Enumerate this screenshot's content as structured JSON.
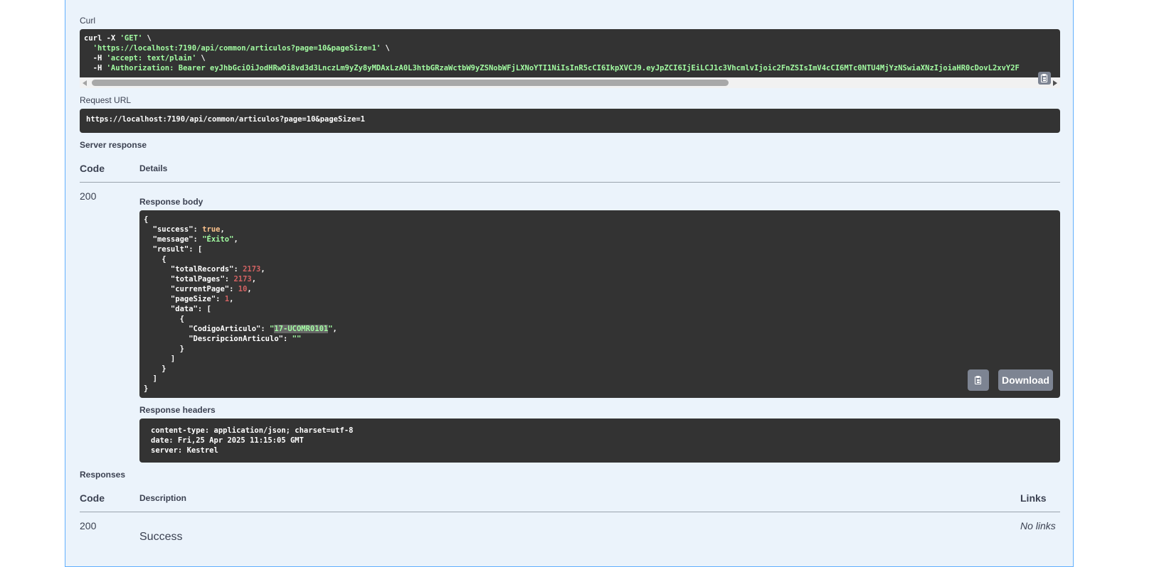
{
  "curl": {
    "label": "Curl",
    "line1_pre": "curl -X ",
    "line1_method": "'GET'",
    "line1_post": " \\",
    "line2_url": "'https://localhost:7190/api/common/articulos?page=10&pageSize=1'",
    "line2_post": " \\",
    "line3_pre": "  -H ",
    "line3_val": "'accept: text/plain'",
    "line3_post": " \\",
    "line4_pre": "  -H ",
    "line4_val": "'Authorization: Bearer eyJhbGciOiJodHRwOi8vd3d3LnczLm9yZy8yMDAxLzA0L3htbGRzaWctbW9yZSNobWFjLXNoYTI1NiIsInR5cCI6IkpXVCJ9.eyJpZCI6IjEiLCJ1c3VhcmlvIjoic2FnZSIsImV4cCI6MTc0NTU4MjYzNSwiaXNzIjoiaHR0cDovL2xvY2F"
  },
  "request_url": {
    "label": "Request URL",
    "value": "https://localhost:7190/api/common/articulos?page=10&pageSize=1"
  },
  "server_response": {
    "label": "Server response",
    "col_code": "Code",
    "col_details": "Details",
    "code": "200",
    "body_label": "Response body",
    "body": {
      "open": "{",
      "k_success": "  \"success\"",
      "v_success": "true",
      "k_message": "  \"message\"",
      "v_message": "\"Éxito\"",
      "k_result": "  \"result\"",
      "open_arr": "[",
      "open_obj": "    {",
      "k_totalRecords": "      \"totalRecords\"",
      "v_totalRecords": "2173",
      "k_totalPages": "      \"totalPages\"",
      "v_totalPages": "2173",
      "k_currentPage": "      \"currentPage\"",
      "v_currentPage": "10",
      "k_pageSize": "      \"pageSize\"",
      "v_pageSize": "1",
      "k_data": "      \"data\"",
      "open_obj2": "        {",
      "k_codigo": "          \"CodigoArticulo\"",
      "v_codigo": "17-UCOMR0101",
      "k_desc": "          \"DescripcionArticulo\"",
      "v_desc": "\"\"",
      "close_obj2": "        }",
      "close_arr2": "      ]",
      "close_obj": "    }",
      "close_arr": "  ]",
      "close": "}"
    },
    "download_label": "Download",
    "headers_label": "Response headers",
    "headers": [
      "content-type: application/json; charset=utf-8",
      "date: Fri,25 Apr 2025 11:15:05 GMT",
      "server: Kestrel"
    ]
  },
  "responses": {
    "label": "Responses",
    "col_code": "Code",
    "col_description": "Description",
    "col_links": "Links",
    "code": "200",
    "description": "Success",
    "links": "No links"
  },
  "colors": {
    "code_bg": "#333333",
    "string": "#a2fca2",
    "keyword": "#fcc28c",
    "number": "#d36363",
    "panel_bg": "#ebf3fb",
    "panel_border": "#61affe",
    "button": "#7d8492"
  },
  "icons": [
    "copy-icon",
    "scroll-left-arrow-icon",
    "scroll-right-arrow-icon"
  ]
}
